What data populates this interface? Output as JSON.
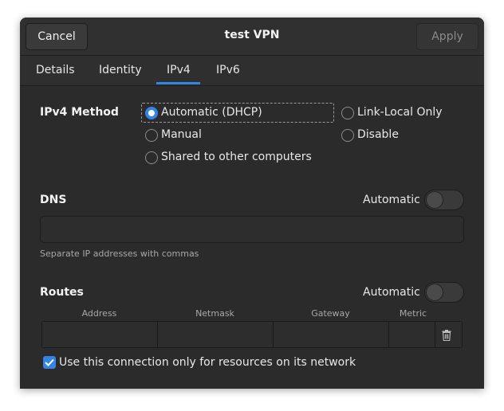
{
  "header": {
    "title": "test VPN",
    "cancel_label": "Cancel",
    "apply_label": "Apply"
  },
  "tabs": [
    {
      "label": "Details"
    },
    {
      "label": "Identity"
    },
    {
      "label": "IPv4"
    },
    {
      "label": "IPv6"
    }
  ],
  "ipv4": {
    "method_label": "IPv4 Method",
    "options": {
      "automatic": "Automatic (DHCP)",
      "manual": "Manual",
      "shared": "Shared to other computers",
      "link_local": "Link-Local Only",
      "disable": "Disable"
    },
    "selected": "automatic"
  },
  "dns": {
    "label": "DNS",
    "automatic_label": "Automatic",
    "automatic_on": false,
    "value": "",
    "hint": "Separate IP addresses with commas"
  },
  "routes": {
    "label": "Routes",
    "automatic_label": "Automatic",
    "automatic_on": false,
    "columns": [
      "Address",
      "Netmask",
      "Gateway",
      "Metric"
    ]
  },
  "use_only_for_network": {
    "label": "Use this connection only for resources on its network",
    "checked": true
  },
  "colors": {
    "accent": "#3584e4",
    "background": "#2b2b2b"
  }
}
